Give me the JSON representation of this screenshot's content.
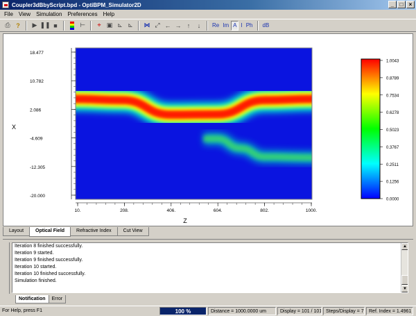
{
  "window": {
    "title": "Coupler3dBbyScript.bpd - OptiBPM_Simulator2D"
  },
  "menu": [
    "File",
    "View",
    "Simulation",
    "Preferences",
    "Help"
  ],
  "toolbar": {
    "text_buttons": [
      "Re",
      "Im",
      "A",
      "I",
      "Ph",
      "dB"
    ],
    "active_text_button": "A"
  },
  "main_tabs": [
    {
      "label": "Layout",
      "active": false
    },
    {
      "label": "Optical Field",
      "active": true
    },
    {
      "label": "Refractive Index",
      "active": false
    },
    {
      "label": "Cut View",
      "active": false
    }
  ],
  "chart_data": {
    "type": "heatmap",
    "title": "",
    "xlabel": "Z",
    "ylabel": "X",
    "x_ticks": [
      "10.",
      "208.",
      "406.",
      "604.",
      "802.",
      "1000."
    ],
    "y_ticks": [
      "18.477",
      "10.782",
      "2.086",
      "-4.609",
      "-12.305",
      "-20.000"
    ],
    "xlim": [
      10,
      1000
    ],
    "ylim": [
      -20.0,
      18.477
    ],
    "colorbar_ticks": [
      "1.0043",
      "0.8789",
      "0.7534",
      "0.6278",
      "0.5023",
      "0.3767",
      "0.2511",
      "0.1256",
      "0.0000"
    ],
    "colorbar_range": [
      0.0,
      1.0043
    ],
    "colormap": [
      "#0000ff",
      "#00ffff",
      "#00ff00",
      "#ffff00",
      "#ff0000"
    ],
    "waveguides": [
      {
        "z": [
          10,
          208,
          406,
          604,
          802,
          1000
        ],
        "x": [
          5.5,
          5.2,
          1.5,
          1.6,
          5.2,
          5.5
        ],
        "peak": 1.0043
      },
      {
        "z": [
          604,
          700,
          802,
          1000
        ],
        "x": [
          -4.6,
          -7.0,
          -9.2,
          -9.4
        ],
        "peak": 0.3
      }
    ]
  },
  "log": {
    "lines": [
      "Iteration 8 finished successfully.",
      "Iteration 9 started.",
      "Iteration 9 finished successfully.",
      "Iteration 10 started.",
      "Iteration 10 finished successfully.",
      "Simulation finished."
    ]
  },
  "log_tabs": [
    {
      "label": "Notification",
      "active": true
    },
    {
      "label": "Error",
      "active": false
    }
  ],
  "status": {
    "help": "For Help, press F1",
    "progress": "100 %",
    "progress_value": 100,
    "distance": "Distance = 1000.0000 um",
    "display": "Display = 101 / 101",
    "steps": "Steps/Display = 7",
    "ref_index": "Ref. Index = 1.4961"
  }
}
